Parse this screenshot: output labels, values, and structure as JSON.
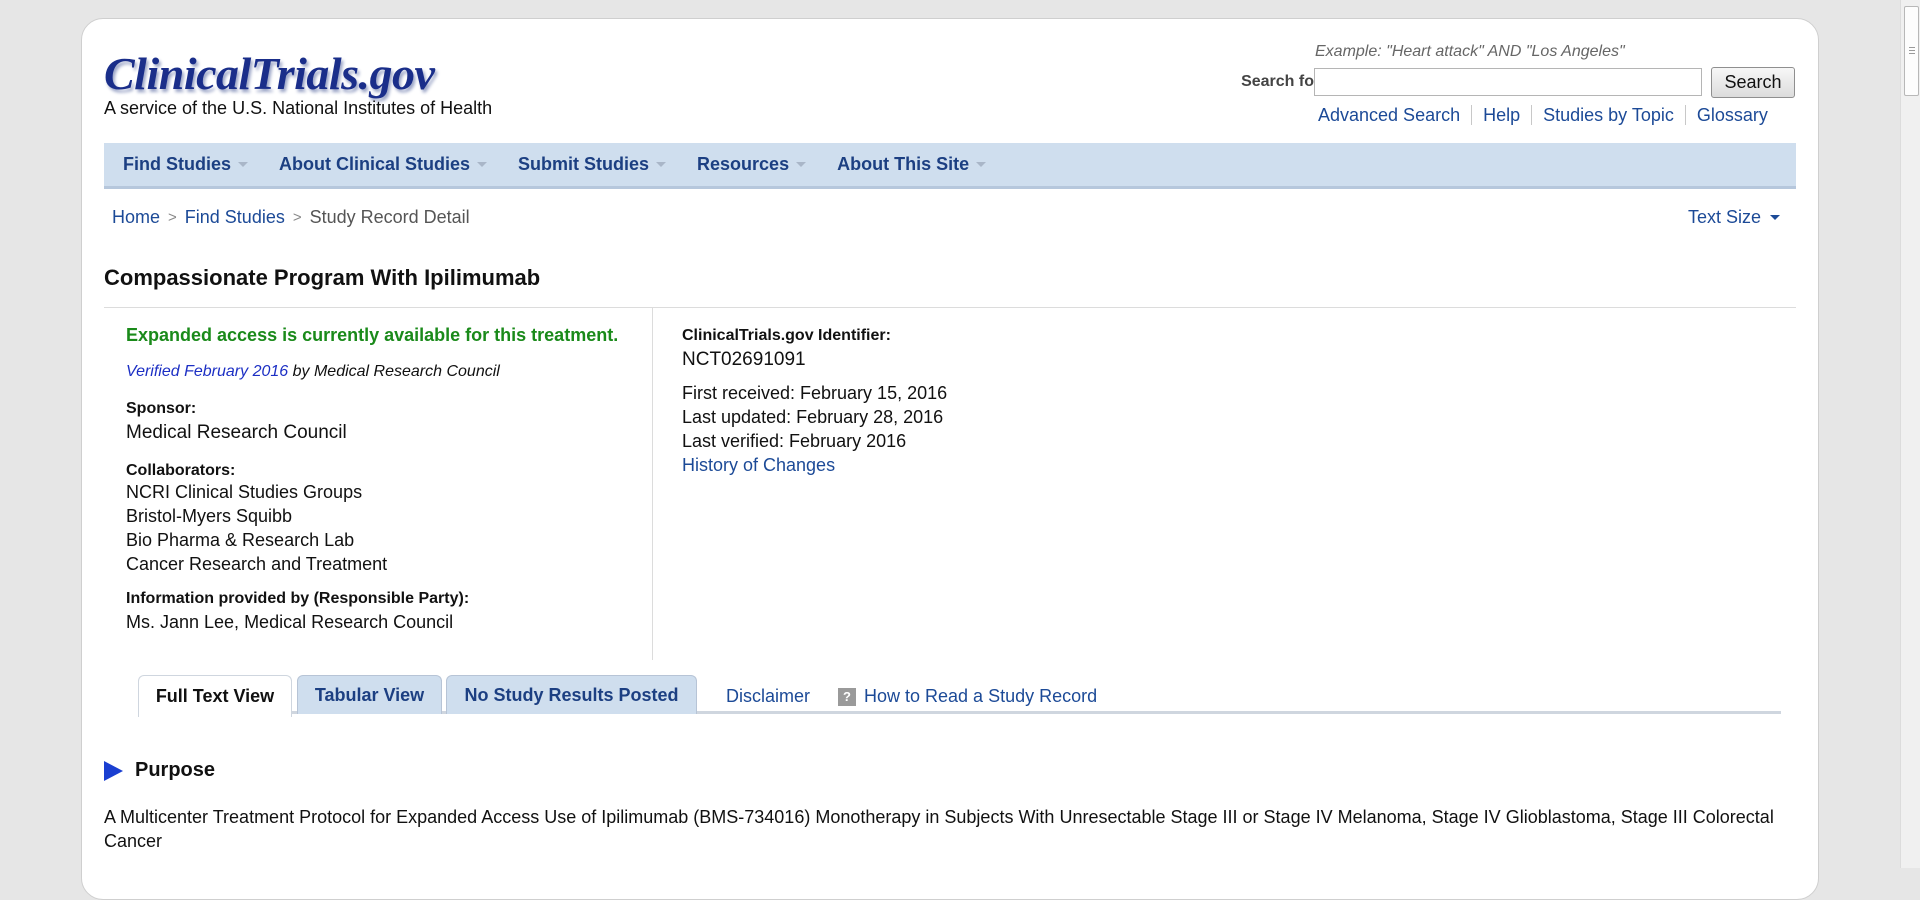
{
  "header": {
    "logo_text": "ClinicalTrials.gov",
    "tagline": "A service of the U.S. National Institutes of Health",
    "search_example": "Example: \"Heart attack\" AND \"Los Angeles\"",
    "search_label": "Search for studies:",
    "search_value": "",
    "search_button": "Search",
    "quick_links": [
      "Advanced Search",
      "Help",
      "Studies by Topic",
      "Glossary"
    ]
  },
  "nav": {
    "items": [
      "Find Studies",
      "About Clinical Studies",
      "Submit Studies",
      "Resources",
      "About This Site"
    ]
  },
  "breadcrumb": {
    "home": "Home",
    "find": "Find Studies",
    "current": "Study Record Detail",
    "separator": ">"
  },
  "text_size_label": "Text Size",
  "study": {
    "title": "Compassionate Program With Ipilimumab",
    "status": "Expanded access is currently available for this treatment.",
    "verified_link": "Verified February 2016",
    "verified_by": " by Medical Research Council",
    "sponsor_label": "Sponsor:",
    "sponsor": "Medical Research Council",
    "collaborators_label": "Collaborators:",
    "collaborators": [
      "NCRI Clinical Studies Groups",
      "Bristol-Myers Squibb",
      "Bio Pharma & Research Lab",
      "Cancer Research and Treatment"
    ],
    "responsible_label": "Information provided by (Responsible Party):",
    "responsible": "Ms. Jann Lee, Medical Research Council",
    "identifier_label": "ClinicalTrials.gov Identifier:",
    "identifier": "NCT02691091",
    "first_received": "First received: February 15, 2016",
    "last_updated": "Last updated: February 28, 2016",
    "last_verified": "Last verified: February 2016",
    "history_link": "History of Changes"
  },
  "tabs": {
    "full_text": "Full Text View",
    "tabular": "Tabular View",
    "no_results": "No Study Results Posted",
    "disclaimer": "Disclaimer",
    "how_to_read": "How to Read a Study Record",
    "help_icon_glyph": "?"
  },
  "purpose": {
    "title": "Purpose",
    "text": "A Multicenter Treatment Protocol for Expanded Access Use of Ipilimumab (BMS-734016) Monotherapy in Subjects With Unresectable Stage III or Stage IV Melanoma, Stage IV Glioblastoma, Stage III Colorectal Cancer"
  },
  "colors": {
    "link": "#1c4a97",
    "nav_bg": "#cfdeee",
    "status_green": "#1a8a1a",
    "logo_blue": "#1a2e8a"
  }
}
